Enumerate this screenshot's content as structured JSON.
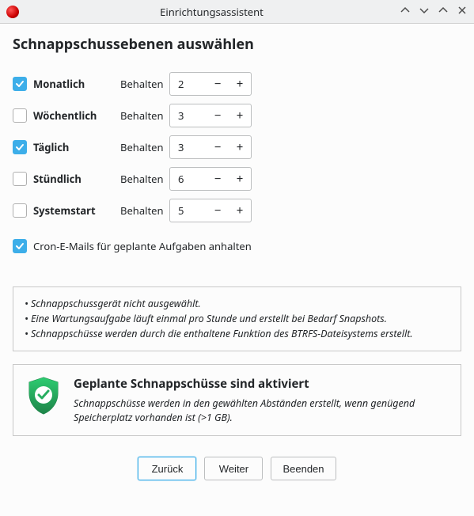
{
  "window": {
    "title": "Einrichtungsassistent"
  },
  "page": {
    "heading": "Schnappschussebenen auswählen"
  },
  "keep_label": "Behalten",
  "levels": [
    {
      "key": "monthly",
      "label": "Monatlich",
      "checked": true,
      "value": "2"
    },
    {
      "key": "weekly",
      "label": "Wöchentlich",
      "checked": false,
      "value": "3"
    },
    {
      "key": "daily",
      "label": "Täglich",
      "checked": true,
      "value": "3"
    },
    {
      "key": "hourly",
      "label": "Stündlich",
      "checked": false,
      "value": "6"
    },
    {
      "key": "boot",
      "label": "Systemstart",
      "checked": false,
      "value": "5"
    }
  ],
  "cron": {
    "checked": true,
    "label": "Cron-E-Mails für geplante Aufgaben anhalten"
  },
  "info": {
    "line1": "• Schnappschussgerät nicht ausgewählt.",
    "line2": "• Eine Wartungsaufgabe läuft einmal pro Stunde und erstellt bei Bedarf Snapshots.",
    "line3": "• Schnappschüsse werden durch die enthaltene Funktion des BTRFS-Dateisystems erstellt."
  },
  "status": {
    "title": "Geplante Schnappschüsse sind aktiviert",
    "desc": "Schnappschüsse werden in den gewählten Abständen erstellt, wenn genügend Speicherplatz vorhanden ist (>1 GB)."
  },
  "footer": {
    "back": "Zurück",
    "next": "Weiter",
    "quit": "Beenden"
  }
}
